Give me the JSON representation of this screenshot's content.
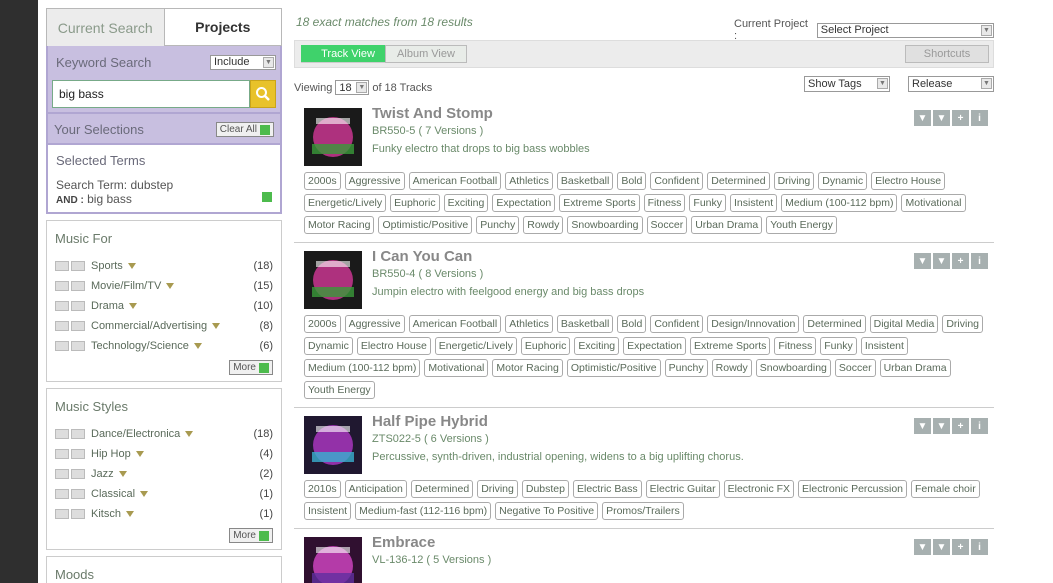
{
  "tabs": {
    "current": "Current Search",
    "projects": "Projects"
  },
  "keyword": {
    "title": "Keyword Search",
    "mode": "Include",
    "value": "big bass"
  },
  "selections": {
    "title": "Your Selections",
    "clear": "Clear All"
  },
  "selected_terms": {
    "title": "Selected Terms",
    "search_term": "Search Term: dubstep",
    "and_label": "AND :",
    "and_value": "big bass"
  },
  "music_for": {
    "title": "Music For",
    "more": "More",
    "items": [
      {
        "label": "Sports",
        "count": "(18)"
      },
      {
        "label": "Movie/Film/TV",
        "count": "(15)"
      },
      {
        "label": "Drama",
        "count": "(10)"
      },
      {
        "label": "Commercial/Advertising",
        "count": "(8)"
      },
      {
        "label": "Technology/Science",
        "count": "(6)"
      }
    ]
  },
  "music_styles": {
    "title": "Music Styles",
    "more": "More",
    "items": [
      {
        "label": "Dance/Electronica",
        "count": "(18)"
      },
      {
        "label": "Hip Hop",
        "count": "(4)"
      },
      {
        "label": "Jazz",
        "count": "(2)"
      },
      {
        "label": "Classical",
        "count": "(1)"
      },
      {
        "label": "Kitsch",
        "count": "(1)"
      }
    ]
  },
  "next_facet": {
    "title": "Moods"
  },
  "header": {
    "matches": "18 exact matches from 18 results",
    "current_project_label": "Current Project :",
    "current_project_value": "Select Project"
  },
  "viewbar": {
    "track_view": "Track View",
    "album_view": "Album View",
    "shortcuts": "Shortcuts"
  },
  "viewing": {
    "label": "Viewing",
    "per_page": "18",
    "suffix": "of 18 Tracks",
    "show_tags": "Show Tags",
    "sort": "Release"
  },
  "tracks": [
    {
      "title": "Twist And Stomp",
      "versions": "BR550-5 ( 7 Versions )",
      "desc": "Funky electro that drops to big bass wobbles",
      "tags": [
        "2000s",
        "Aggressive",
        "American Football",
        "Athletics",
        "Basketball",
        "Bold",
        "Confident",
        "Determined",
        "Driving",
        "Dynamic",
        "Electro House",
        "Energetic/Lively",
        "Euphoric",
        "Exciting",
        "Expectation",
        "Extreme Sports",
        "Fitness",
        "Funky",
        "Insistent",
        "Medium (100-112 bpm)",
        "Motivational",
        "Motor Racing",
        "Optimistic/Positive",
        "Punchy",
        "Rowdy",
        "Snowboarding",
        "Soccer",
        "Urban Drama",
        "Youth Energy"
      ]
    },
    {
      "title": "I Can You Can",
      "versions": "BR550-4 ( 8 Versions )",
      "desc": "Jumpin electro with feelgood energy and big bass drops",
      "tags": [
        "2000s",
        "Aggressive",
        "American Football",
        "Athletics",
        "Basketball",
        "Bold",
        "Confident",
        "Design/Innovation",
        "Determined",
        "Digital Media",
        "Driving",
        "Dynamic",
        "Electro House",
        "Energetic/Lively",
        "Euphoric",
        "Exciting",
        "Expectation",
        "Extreme Sports",
        "Fitness",
        "Funky",
        "Insistent",
        "Medium (100-112 bpm)",
        "Motivational",
        "Motor Racing",
        "Optimistic/Positive",
        "Punchy",
        "Rowdy",
        "Snowboarding",
        "Soccer",
        "Urban Drama",
        "Youth Energy"
      ]
    },
    {
      "title": "Half Pipe Hybrid",
      "versions": "ZTS022-5 ( 6 Versions )",
      "desc": "Percussive, synth-driven, industrial opening, widens to a big uplifting chorus.",
      "tags": [
        "2010s",
        "Anticipation",
        "Determined",
        "Driving",
        "Dubstep",
        "Electric Bass",
        "Electric Guitar",
        "Electronic FX",
        "Electronic Percussion",
        "Female choir",
        "Insistent",
        "Medium-fast (112-116 bpm)",
        "Negative To Positive",
        "Promos/Trailers"
      ]
    },
    {
      "title": "Embrace",
      "versions": "VL-136-12 ( 5 Versions )",
      "desc": "",
      "tags": []
    }
  ],
  "colors": {
    "accent_green": "#3fd26b",
    "lavender": "#c8bfe0",
    "search_yellow": "#e8c22a",
    "icon_grey": "#a7b0b0"
  }
}
